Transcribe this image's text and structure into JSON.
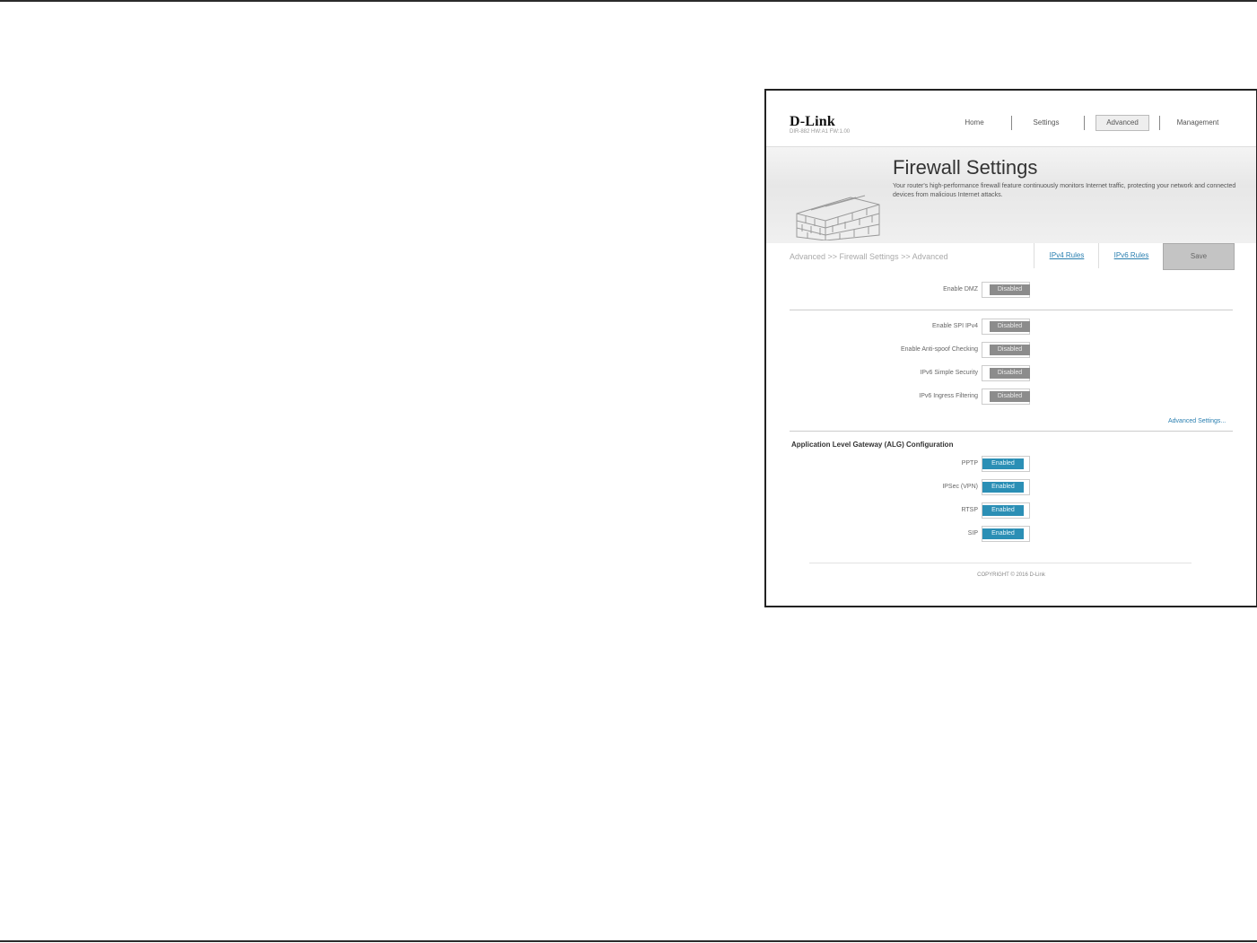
{
  "brand": {
    "name": "D-Link",
    "subtitle": "DIR-882   HW:A1   FW:1.00"
  },
  "nav": {
    "items": [
      {
        "label": "Home",
        "active": false
      },
      {
        "label": "Settings",
        "active": false
      },
      {
        "label": "Advanced",
        "active": true
      },
      {
        "label": "Management",
        "active": false
      }
    ]
  },
  "banner": {
    "title": "Firewall Settings",
    "description": "Your router's high-performance firewall feature continuously monitors Internet traffic, protecting your network and connected devices from malicious Internet attacks."
  },
  "breadcrumb": "Advanced >> Firewall Settings >> Advanced",
  "tabs": {
    "ipv4": "IPv4 Rules",
    "ipv6": "IPv6 Rules",
    "save": "Save"
  },
  "dmz": {
    "label": "Enable DMZ",
    "state": "Disabled"
  },
  "firewall_options": [
    {
      "label": "Enable SPI IPv4",
      "state": "Disabled"
    },
    {
      "label": "Enable Anti-spoof Checking",
      "state": "Disabled"
    },
    {
      "label": "IPv6 Simple Security",
      "state": "Disabled"
    },
    {
      "label": "IPv6 Ingress Filtering",
      "state": "Disabled"
    }
  ],
  "advanced_settings_link": "Advanced Settings...",
  "alg": {
    "title": "Application Level Gateway (ALG) Configuration",
    "items": [
      {
        "label": "PPTP",
        "state": "Enabled"
      },
      {
        "label": "IPSec (VPN)",
        "state": "Enabled"
      },
      {
        "label": "RTSP",
        "state": "Enabled"
      },
      {
        "label": "SIP",
        "state": "Enabled"
      }
    ]
  },
  "copyright": "COPYRIGHT © 2016 D-Link",
  "colors": {
    "enabled": "#2b8fb5",
    "disabled": "#8c8c8c",
    "link": "#2a7fb0"
  }
}
